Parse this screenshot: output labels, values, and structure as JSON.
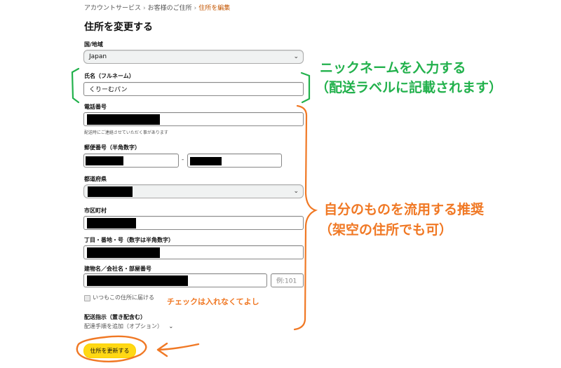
{
  "breadcrumb": {
    "items": [
      "アカウントサービス",
      "お客様のご住所",
      "住所を編集"
    ],
    "separator": "›"
  },
  "page": {
    "title": "住所を変更する"
  },
  "form": {
    "country_label": "国/地域",
    "country_value": "Japan",
    "name_label": "氏名（フルネーム）",
    "name_value": "くりーむパン",
    "phone_label": "電話番号",
    "phone_hint": "配送時にご連絡させていただく事があります",
    "postal_label": "郵便番号（半角数字）",
    "postal_separator": "-",
    "prefecture_label": "都道府県",
    "city_label": "市区町村",
    "street_label": "丁目・番地・号（数字は半角数字）",
    "building_label": "建物名／会社名・部屋番号",
    "building_placeholder": "例:101",
    "default_checkbox_label": "いつもこの住所に届ける",
    "delivery_label": "配送指示（置き配含む）",
    "delivery_link": "配達手順を追加（オプション）",
    "submit_label": "住所を更新する"
  },
  "annotations": {
    "nickname_line1": "ニックネームを入力する",
    "nickname_line2": "（配送ラベルに記載されます）",
    "own_info_line1": "自分のものを流用する推奨",
    "own_info_line2": "（架空の住所でも可）",
    "checkbox_note": "チェックは入れなくてよし"
  },
  "colors": {
    "annotation_green": "#22b14c",
    "annotation_orange": "#f07824",
    "button_yellow": "#ffd814",
    "breadcrumb_current": "#c45500"
  }
}
